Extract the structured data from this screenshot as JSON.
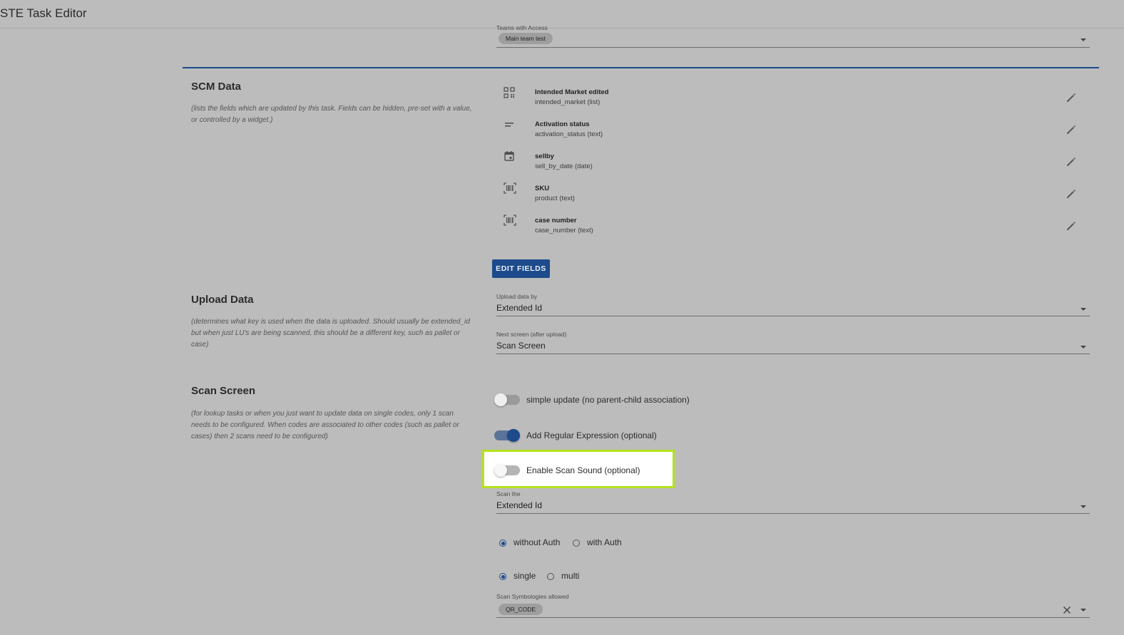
{
  "app": {
    "title": "STE Task Editor"
  },
  "teams": {
    "label": "Teams with Access",
    "chip": "Main team test"
  },
  "scm": {
    "title": "SCM Data",
    "description": "(lists the fields which are updated by this task. Fields can be hidden, pre-set with a value, or controlled by a widget.)",
    "fields": [
      {
        "title": "Intended Market edited",
        "sub": "intended_market (list)",
        "icon": "qr-code-icon"
      },
      {
        "title": "Activation status",
        "sub": "activation_status (text)",
        "icon": "short-text-icon"
      },
      {
        "title": "sellby",
        "sub": "sell_by_date (date)",
        "icon": "calendar-icon"
      },
      {
        "title": "SKU",
        "sub": "product (text)",
        "icon": "barcode-scan-icon"
      },
      {
        "title": "case number",
        "sub": "case_number (text)",
        "icon": "barcode-scan-icon"
      }
    ],
    "edit_button": "EDIT FIELDS"
  },
  "upload": {
    "title": "Upload Data",
    "description": "(determines what key is used when the data is uploaded. Should usually be extended_id but when just LU's are being scanned, this should be a different key, such as pallet or case)",
    "upload_by_label": "Upload data by",
    "upload_by_value": "Extended Id",
    "next_screen_label": "Next screen (after upload)",
    "next_screen_value": "Scan Screen"
  },
  "scan": {
    "title": "Scan Screen",
    "description": "(for lookup tasks or when you just want to update data on single codes, only 1 scan needs to be configured. When codes are associated to other codes (such as pallet or cases) then 2 scans need to be configured)",
    "toggles": [
      {
        "label": "simple update (no parent-child association)",
        "on": false
      },
      {
        "label": "Add Regular Expression (optional)",
        "on": true
      },
      {
        "label": "Enable Scan Sound (optional)",
        "on": false
      }
    ],
    "scan_the_label": "Scan the",
    "scan_the_value": "Extended Id",
    "auth_options": [
      "without Auth",
      "with Auth"
    ],
    "auth_selected": "without Auth",
    "mode_options": [
      "single",
      "multi"
    ],
    "mode_selected": "single",
    "symbologies_label": "Scan Symbologies allowed",
    "symbologies_chip": "QR_CODE"
  },
  "colors": {
    "accent": "#1d4b8b",
    "highlight_border": "#b5e21b",
    "background": "#bcbcbc"
  }
}
